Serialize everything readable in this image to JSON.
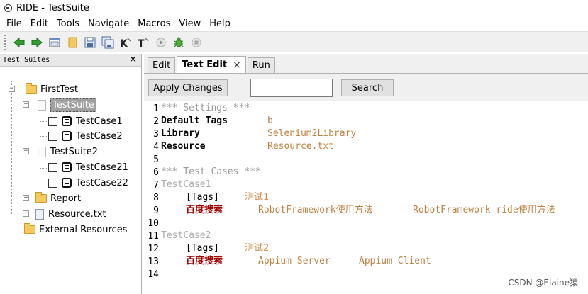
{
  "window": {
    "title": "RIDE - TestSuite"
  },
  "menu": [
    "File",
    "Edit",
    "Tools",
    "Navigate",
    "Macros",
    "View",
    "Help"
  ],
  "toolbar": {
    "icons": [
      "back-arrow-icon",
      "forward-arrow-icon",
      "open-suite-icon",
      "open-file-icon",
      "save-icon",
      "save-all-icon",
      "search-keywords-icon",
      "search-tests-icon",
      "run-icon",
      "debug-bug-icon",
      "stop-icon"
    ]
  },
  "left_panel": {
    "title": "Test Suites",
    "close": "✕",
    "tree": {
      "root": "FirstTest",
      "suite1": "TestSuite",
      "suite1_cases": [
        "TestCase1",
        "TestCase2"
      ],
      "suite2": "TestSuite2",
      "suite2_cases": [
        "TestCase21",
        "TestCase22"
      ],
      "report": "Report",
      "resource": "Resource.txt",
      "external": "External Resources"
    }
  },
  "tabs": {
    "edit": "Edit",
    "text_edit": "Text Edit",
    "run": "Run",
    "close": "×"
  },
  "actions": {
    "apply": "Apply Changes",
    "search_value": "",
    "search": "Search"
  },
  "editor": {
    "l1": "*** Settings ***",
    "l2a": "Default Tags",
    "l2b": "b",
    "l3a": "Library",
    "l3b": "Selenium2Library",
    "l4a": "Resource",
    "l4b": "Resource.txt",
    "l6": "*** Test Cases ***",
    "l7": "TestCase1",
    "l8a": "[Tags]",
    "l8b": "测试1",
    "l9a": "百度搜索",
    "l9b": "RobotFramework使用方法",
    "l9c": "RobotFramework-ride使用方法",
    "l11": "TestCase2",
    "l12a": "[Tags]",
    "l12b": "测试2",
    "l13a": "百度搜索",
    "l13b": "Appium Server",
    "l13c": "Appium Client",
    "line_numbers": [
      "1",
      "2",
      "3",
      "4",
      "5",
      "6",
      "7",
      "8",
      "9",
      "10",
      "11",
      "12",
      "13",
      "14"
    ]
  },
  "watermark": "CSDN @Elaine猿"
}
